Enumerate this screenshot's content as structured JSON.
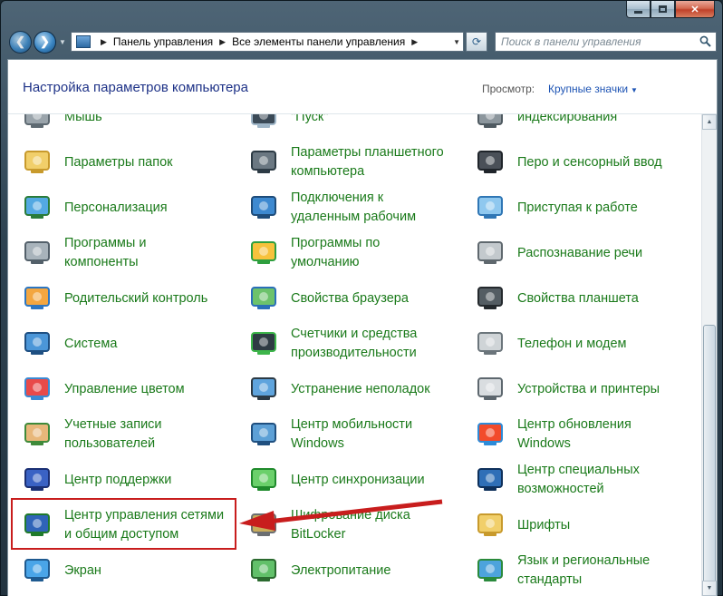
{
  "window": {
    "minimize_glyph": "",
    "close_glyph": "✕"
  },
  "nav": {
    "back_glyph": "❮",
    "forward_glyph": "❯",
    "breadcrumb": [
      "Панель управления",
      "Все элементы панели управления"
    ],
    "search_placeholder": "Поиск в панели управления"
  },
  "header": {
    "title": "Настройка параметров компьютера",
    "view_label": "Просмотр:",
    "view_value": "Крупные значки"
  },
  "items": [
    {
      "label": "Мышь",
      "icon": "mouse-icon"
    },
    {
      "label": "\"Пуск\"",
      "icon": "taskbar-icon"
    },
    {
      "label": "индексирования",
      "icon": "indexing-icon"
    },
    {
      "label": "Параметры папок",
      "icon": "folder-options-icon"
    },
    {
      "label": "Параметры планшетного\nкомпьютера",
      "icon": "tablet-pc-icon"
    },
    {
      "label": "Перо и сенсорный ввод",
      "icon": "pen-icon"
    },
    {
      "label": "Персонализация",
      "icon": "personalization-icon"
    },
    {
      "label": "Подключения к\nудаленным рабочим",
      "icon": "remote-desktop-icon"
    },
    {
      "label": "Приступая к работе",
      "icon": "getting-started-icon"
    },
    {
      "label": "Программы и\nкомпоненты",
      "icon": "programs-icon"
    },
    {
      "label": "Программы по\nумолчанию",
      "icon": "default-programs-icon"
    },
    {
      "label": "Распознавание речи",
      "icon": "microphone-icon"
    },
    {
      "label": "Родительский контроль",
      "icon": "parental-controls-icon"
    },
    {
      "label": "Свойства браузера",
      "icon": "internet-options-icon"
    },
    {
      "label": "Свойства планшета",
      "icon": "tablet-icon"
    },
    {
      "label": "Система",
      "icon": "system-icon"
    },
    {
      "label": "Счетчики и средства\nпроизводительности",
      "icon": "performance-icon"
    },
    {
      "label": "Телефон и модем",
      "icon": "phone-modem-icon"
    },
    {
      "label": "Управление цветом",
      "icon": "color-management-icon"
    },
    {
      "label": "Устранение неполадок",
      "icon": "troubleshooting-icon"
    },
    {
      "label": "Устройства и принтеры",
      "icon": "printer-icon"
    },
    {
      "label": "Учетные записи\nпользователей",
      "icon": "user-accounts-icon"
    },
    {
      "label": "Центр мобильности\nWindows",
      "icon": "mobility-center-icon"
    },
    {
      "label": "Центр обновления\nWindows",
      "icon": "windows-update-icon"
    },
    {
      "label": "Центр поддержки",
      "icon": "action-center-flag-icon"
    },
    {
      "label": "Центр синхронизации",
      "icon": "sync-center-icon"
    },
    {
      "label": "Центр специальных\nвозможностей",
      "icon": "ease-of-access-icon"
    },
    {
      "label": "Центр управления сетями\nи общим доступом",
      "icon": "network-center-icon"
    },
    {
      "label": "Шифрование диска\nBitLocker",
      "icon": "bitlocker-icon"
    },
    {
      "label": "Шрифты",
      "icon": "fonts-icon"
    },
    {
      "label": "Экран",
      "icon": "display-icon"
    },
    {
      "label": "Электропитание",
      "icon": "power-options-icon"
    },
    {
      "label": "Язык и региональные\nстандарты",
      "icon": "region-language-icon"
    }
  ],
  "colors": {
    "link_green": "#1a7a1a",
    "header_blue": "#1e3287",
    "annotation_red": "#c81d1d"
  }
}
